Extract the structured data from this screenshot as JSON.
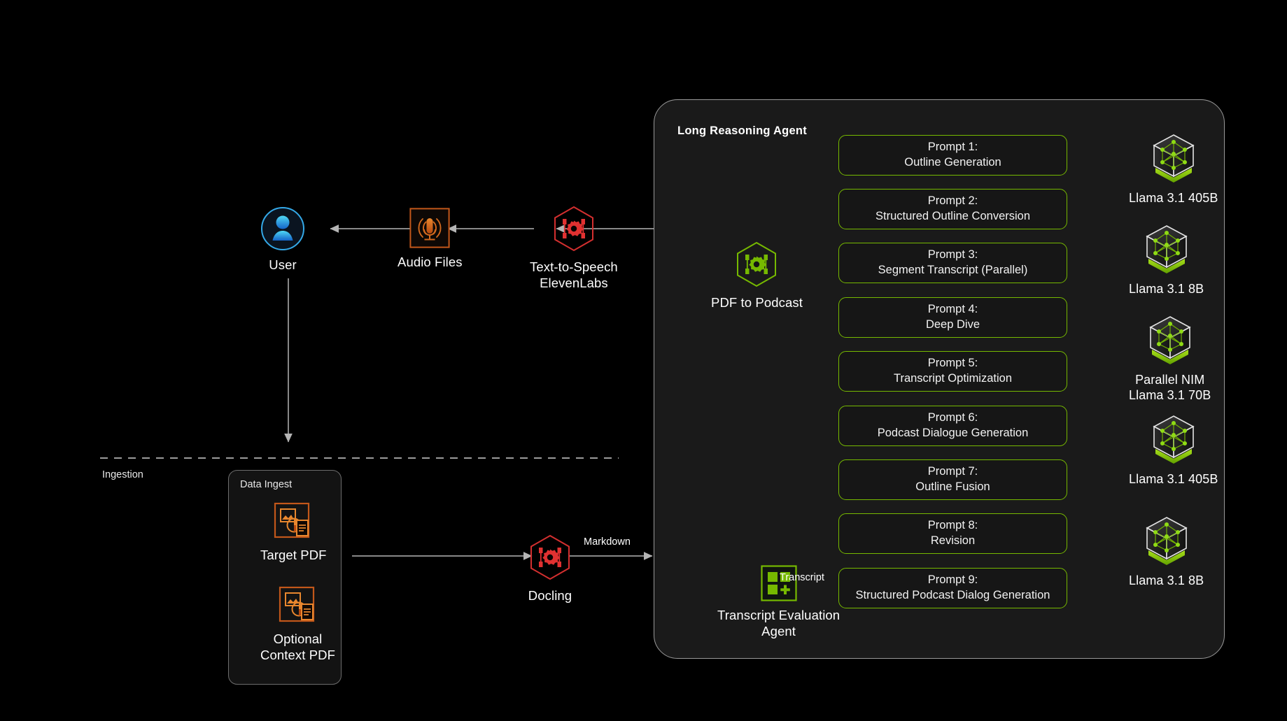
{
  "diagram": {
    "title": "PDF to Podcast multi-agent architecture",
    "background": "#000000",
    "accent_green": "#76b900",
    "accent_red": "#d32f2f",
    "accent_orange": "#d2691e",
    "accent_blue": "#1f78d1"
  },
  "flow_top": {
    "user": {
      "label": "User",
      "icon": "user-avatar-icon"
    },
    "audio_files": {
      "label": "Audio Files",
      "icon": "microphone-audio-icon"
    },
    "tts": {
      "label": "Text-to-Speech\nElevenLabs",
      "icon": "red-hexagon-gear-icon"
    }
  },
  "ingestion": {
    "section_label": "Ingestion",
    "box_title": "Data Ingest",
    "items": [
      {
        "label": "Target PDF",
        "icon": "pdf-documents-icon"
      },
      {
        "label": "Optional\nContext PDF",
        "icon": "pdf-documents-icon"
      }
    ]
  },
  "docling": {
    "label": "Docling",
    "icon": "red-hexagon-gear-icon"
  },
  "pdf_to_podcast": {
    "label": "PDF to Podcast",
    "icon": "green-hexagon-gear-icon"
  },
  "transcript_eval_agent": {
    "label": "Transcript Evaluation\nAgent",
    "icon": "green-squares-plus-icon"
  },
  "edge_labels": {
    "markdown": "Markdown",
    "transcript": "Transcript"
  },
  "agent": {
    "title": "Long Reasoning Agent",
    "prompts": [
      {
        "line1": "Prompt 1:",
        "line2": "Outline Generation"
      },
      {
        "line1": "Prompt 2:",
        "line2": "Structured Outline Conversion"
      },
      {
        "line1": "Prompt 3:",
        "line2": "Segment Transcript (Parallel)"
      },
      {
        "line1": "Prompt 4:",
        "line2": "Deep Dive"
      },
      {
        "line1": "Prompt 5:",
        "line2": "Transcript Optimization"
      },
      {
        "line1": "Prompt 6:",
        "line2": "Podcast Dialogue Generation"
      },
      {
        "line1": "Prompt 7:",
        "line2": "Outline Fusion"
      },
      {
        "line1": "Prompt 8:",
        "line2": "Revision"
      },
      {
        "line1": "Prompt 9:",
        "line2": "Structured Podcast Dialog Generation"
      }
    ]
  },
  "models": [
    {
      "label": "Llama 3.1 405B",
      "icon": "nim-cube-icon"
    },
    {
      "label": "Llama 3.1 8B",
      "icon": "nim-cube-icon"
    },
    {
      "label": "Parallel NIM\nLlama 3.1 70B",
      "icon": "nim-cube-icon"
    },
    {
      "label": "Llama 3.1 405B",
      "icon": "nim-cube-icon"
    },
    {
      "label": "Llama 3.1 8B",
      "icon": "nim-cube-icon"
    }
  ]
}
